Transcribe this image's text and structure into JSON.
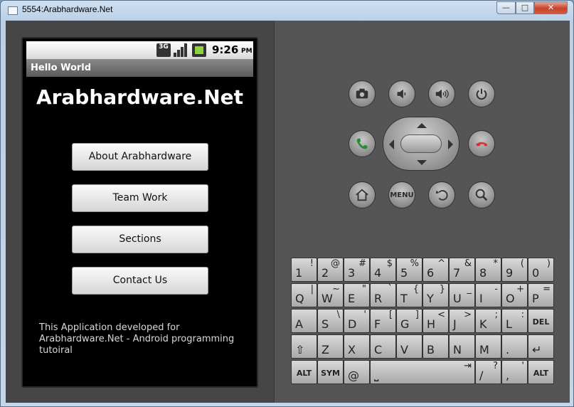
{
  "window": {
    "title": "5554:Arabhardware.Net",
    "min_label": "—",
    "max_label": "□",
    "close_label": "✕"
  },
  "status_bar": {
    "network": "3G",
    "time": "9:26",
    "ampm": "PM",
    "battery_color": "#8ed43c"
  },
  "app": {
    "title": "Hello World",
    "heading": "Arabhardware.Net",
    "buttons": [
      "About Arabhardware",
      "Team Work",
      "Sections",
      "Contact Us"
    ],
    "footer": "This Application developed for Arabhardware.Net - Android programming tutoiral"
  },
  "hardware_buttons": {
    "top_row": [
      "camera-icon",
      "volume-down-icon",
      "volume-up-icon",
      "power-icon"
    ],
    "call_color": "#2a8a3a",
    "end_call_color": "#c83a3a",
    "bottom_row": [
      "home-icon",
      "menu",
      "back-icon",
      "search-icon"
    ],
    "menu_label": "MENU"
  },
  "keyboard": {
    "row1": [
      [
        "1",
        "!"
      ],
      [
        "2",
        "@"
      ],
      [
        "3",
        "#"
      ],
      [
        "4",
        "$"
      ],
      [
        "5",
        "%"
      ],
      [
        "6",
        "^"
      ],
      [
        "7",
        "&"
      ],
      [
        "8",
        "*"
      ],
      [
        "9",
        "("
      ],
      [
        "0",
        ")"
      ]
    ],
    "row2": [
      [
        "Q",
        "|"
      ],
      [
        "W",
        "~"
      ],
      [
        "E",
        "\""
      ],
      [
        "R",
        "`"
      ],
      [
        "T",
        "{"
      ],
      [
        "Y",
        "}"
      ],
      [
        "U",
        "_"
      ],
      [
        "I",
        "-"
      ],
      [
        "O",
        "+"
      ],
      [
        "P",
        "="
      ]
    ],
    "row3": [
      [
        "A",
        ""
      ],
      [
        "S",
        "\\"
      ],
      [
        "D",
        "'"
      ],
      [
        "F",
        "["
      ],
      [
        "G",
        "]"
      ],
      [
        "H",
        "<"
      ],
      [
        "J",
        ">"
      ],
      [
        "K",
        ";"
      ],
      [
        "L",
        ":"
      ]
    ],
    "del_label": "DEL",
    "row4": [
      [
        "Z",
        ""
      ],
      [
        "X",
        ""
      ],
      [
        "C",
        ""
      ],
      [
        "V",
        ""
      ],
      [
        "B",
        ""
      ],
      [
        "N",
        ""
      ],
      [
        "M",
        ""
      ],
      [
        ".",
        ""
      ]
    ],
    "alt_label": "ALT",
    "sym_label": "SYM",
    "at_label": "@",
    "slash": [
      "/",
      "?"
    ],
    "comma": [
      ",",
      "'"
    ]
  }
}
